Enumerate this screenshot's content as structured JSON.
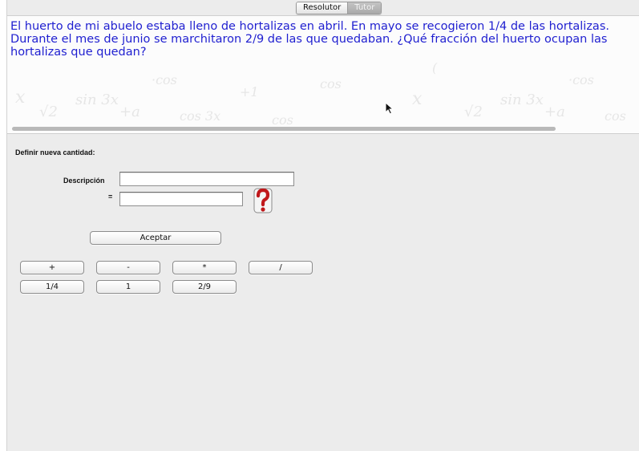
{
  "tabs": [
    {
      "label": "Resolutor",
      "active": true
    },
    {
      "label": "Tutor",
      "active": false
    }
  ],
  "problem": {
    "text": "El huerto de mi abuelo estaba lleno de hortalizas en abril. En mayo se recogieron 1/4 de las hortalizas. Durante el mes de junio se marchitaron 2/9 de las que quedaban. ¿Qué fracción del huerto ocupan las hortalizas que quedan?",
    "text_color": "#1f1fd0"
  },
  "form": {
    "title": "Definir nueva cantidad:",
    "description_label": "Descripción",
    "description_value": "",
    "equals_label": "=",
    "value_input": "",
    "accept_label": "Aceptar",
    "help_icon": "question-mark-icon"
  },
  "operators": [
    "+",
    "-",
    "*",
    "/"
  ],
  "quantities": [
    "1/4",
    "1",
    "2/9"
  ]
}
